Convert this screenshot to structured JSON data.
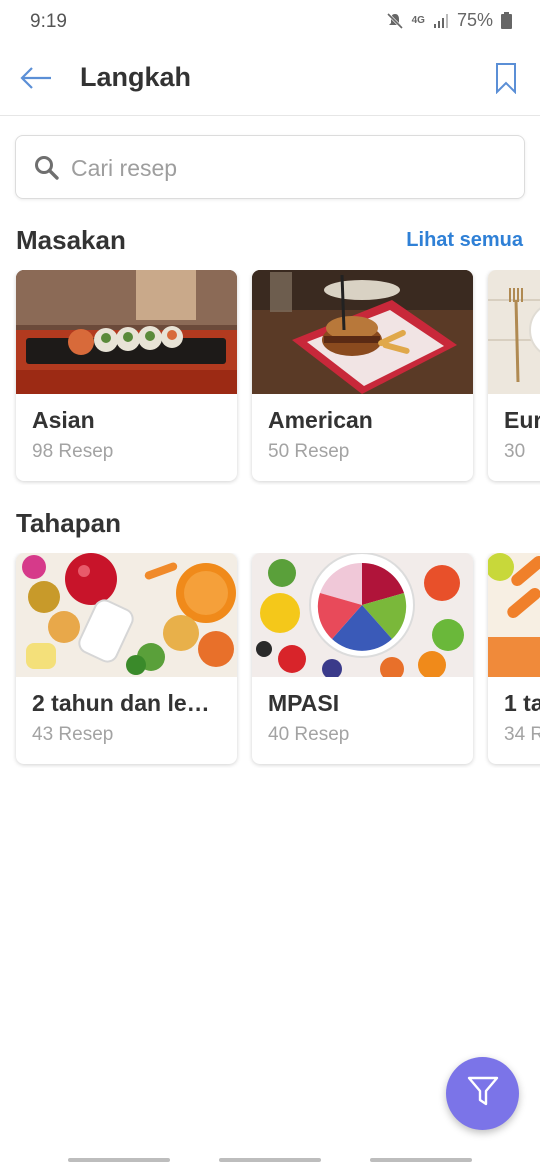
{
  "status_bar": {
    "time": "9:19",
    "network": "4G",
    "battery": "75%",
    "icons": [
      "mute-icon",
      "signal-icon",
      "battery-icon"
    ]
  },
  "app_bar": {
    "title": "Langkah",
    "back_icon": "arrow-left-icon",
    "bookmark_icon": "bookmark-icon"
  },
  "search": {
    "placeholder": "Cari resep",
    "value": ""
  },
  "masakan": {
    "title": "Masakan",
    "see_all": "Lihat semua",
    "cards": [
      {
        "title": "Asian",
        "count": "98 Resep"
      },
      {
        "title": "American",
        "count": "50 Resep"
      },
      {
        "title": "Eur",
        "count": "30"
      }
    ]
  },
  "tahapan": {
    "title": "Tahapan",
    "cards": [
      {
        "title": "2 tahun dan le…",
        "count": "43 Resep"
      },
      {
        "title": "MPASI",
        "count": "40 Resep"
      },
      {
        "title": "1 ta",
        "count": "34 R"
      }
    ]
  },
  "fab": {
    "icon": "filter-icon"
  },
  "colors": {
    "accent": "#2f80d6",
    "fab": "#7b74e8"
  }
}
